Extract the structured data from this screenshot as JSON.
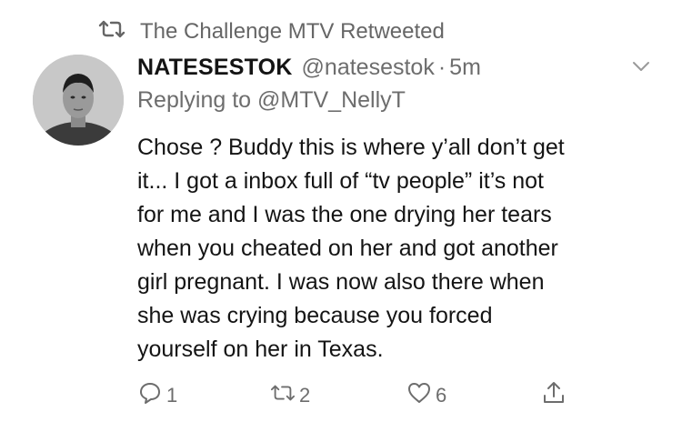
{
  "social_context": {
    "icon": "retweet-icon",
    "text": "The Challenge MTV Retweeted"
  },
  "tweet": {
    "display_name": "NATESESTOK",
    "handle": "@natesestok",
    "separator": "·",
    "time": "5m",
    "reply_prefix": "Replying to",
    "reply_to": "@MTV_NellyT",
    "body_lines": [
      "Chose ? Buddy this is where y’all don’t get",
      "it... I got a inbox full of “tv people” it’s not",
      "for me and I was the one drying her tears",
      "when you cheated on her and got another",
      "girl pregnant. I was now also there when",
      "she was crying because you forced",
      "yourself on her in Texas."
    ]
  },
  "actions": {
    "reply_count": "1",
    "retweet_count": "2",
    "like_count": "6"
  },
  "colors": {
    "text": "#141414",
    "muted": "#6d6d6d",
    "background": "#ffffff"
  }
}
